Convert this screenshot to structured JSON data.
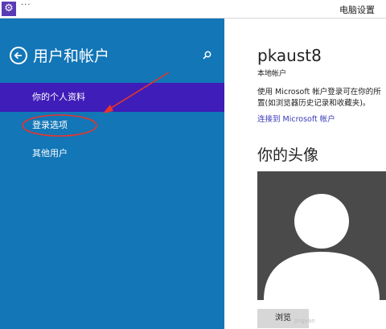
{
  "window": {
    "title_dots": "···",
    "title": "电脑设置"
  },
  "sidebar": {
    "title": "用户和帐户",
    "items": [
      {
        "label": "你的个人资料",
        "selected": true
      },
      {
        "label": "登录选项",
        "selected": false
      },
      {
        "label": "其他用户",
        "selected": false
      }
    ]
  },
  "main": {
    "user_name": "pkaust8",
    "account_type": "本地帐户",
    "description_line1": "使用 Microsoft 帐户登录可在你的所",
    "description_line2": "置(如浏览器历史记录和收藏夹)。",
    "connect_link": "连接到 Microsoft 帐户",
    "avatar_title": "你的头像",
    "browse_button": "浏览",
    "watermark": "jingyan"
  },
  "colors": {
    "left_pane": "#1276b7",
    "selected_item": "#3f1db8",
    "link": "#3a3ab8",
    "annotation": "#e8352b"
  }
}
